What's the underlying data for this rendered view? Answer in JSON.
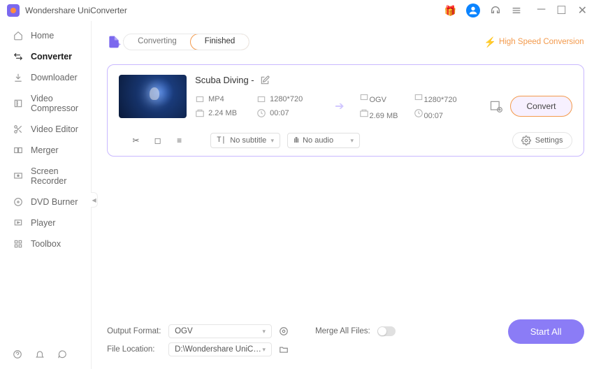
{
  "app": {
    "title": "Wondershare UniConverter"
  },
  "sidebar": {
    "items": [
      {
        "label": "Home",
        "icon": "home"
      },
      {
        "label": "Converter",
        "icon": "convert",
        "active": true
      },
      {
        "label": "Downloader",
        "icon": "download"
      },
      {
        "label": "Video Compressor",
        "icon": "compress"
      },
      {
        "label": "Video Editor",
        "icon": "editor"
      },
      {
        "label": "Merger",
        "icon": "merger"
      },
      {
        "label": "Screen Recorder",
        "icon": "recorder"
      },
      {
        "label": "DVD Burner",
        "icon": "dvd"
      },
      {
        "label": "Player",
        "icon": "player"
      },
      {
        "label": "Toolbox",
        "icon": "toolbox"
      }
    ]
  },
  "topbar": {
    "tabs": {
      "converting": "Converting",
      "finished": "Finished"
    },
    "high_speed": "High Speed Conversion"
  },
  "file": {
    "title": "Scuba Diving -",
    "source": {
      "format": "MP4",
      "resolution": "1280*720",
      "size": "2.24 MB",
      "duration": "00:07"
    },
    "target": {
      "format": "OGV",
      "resolution": "1280*720",
      "size": "2.69 MB",
      "duration": "00:07"
    },
    "convert_btn": "Convert",
    "no_subtitle": "No subtitle",
    "no_audio": "No audio",
    "settings": "Settings"
  },
  "bottom": {
    "output_format_label": "Output Format:",
    "output_format_value": "OGV",
    "file_location_label": "File Location:",
    "file_location_value": "D:\\Wondershare UniConverter",
    "merge_label": "Merge All Files:",
    "start_all": "Start All"
  }
}
